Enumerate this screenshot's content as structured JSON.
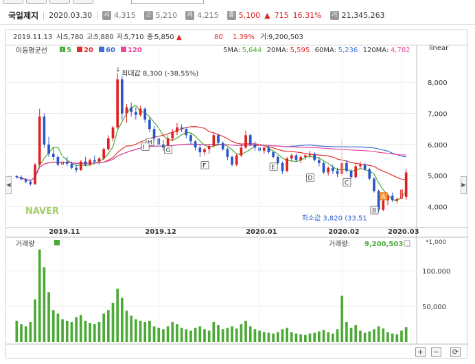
{
  "header": {
    "stock_name": "국일제지",
    "date": "2020.03.30",
    "items": [
      {
        "badge": "시",
        "value": "4,315"
      },
      {
        "badge": "고",
        "value": "5,210"
      },
      {
        "badge": "저",
        "value": "4,215"
      }
    ],
    "close_badge": "종",
    "close": "5,100",
    "change_arrow": "▲",
    "change": "715",
    "change_pct": "16.31%",
    "volume_badge": "거",
    "volume": "21,345,263"
  },
  "ohlc_line": {
    "date": "2019.11.13",
    "open_label": "시:",
    "open": "5,780",
    "high_label": "고:",
    "high": "5,880",
    "low_label": "저:",
    "low": "5,710",
    "close_label": "종:",
    "close": "5,850",
    "arrow": "▲",
    "change": "80",
    "pct": "1.39%",
    "volume_label": "거:",
    "volume": "9,200,503"
  },
  "ma_legend": {
    "title": "이동평균선",
    "periods": [
      {
        "label": "5",
        "color": "#4aaa35"
      },
      {
        "label": "20",
        "color": "#e02d2d"
      },
      {
        "label": "60",
        "color": "#3a6fd8"
      },
      {
        "label": "120",
        "color": "#e8489a"
      }
    ],
    "values": [
      {
        "label": "5MA:",
        "value": "5,644",
        "color": "#4aaa35"
      },
      {
        "label": "20MA:",
        "value": "5,595",
        "color": "#e02d2d"
      },
      {
        "label": "60MA:",
        "value": "5,236",
        "color": "#3a6fd8"
      },
      {
        "label": "120MA:",
        "value": "4,782",
        "color": "#e8489a"
      }
    ]
  },
  "scale_label": "linear",
  "price_ticks": [
    "8,000",
    "7,000",
    "6,000",
    "5,000",
    "4,000"
  ],
  "date_ticks": [
    "2019.11",
    "2019.12",
    "2020.01",
    "2020.02",
    "2020.03"
  ],
  "max_annotation": "최대값 8,300 (-38.55%)",
  "min_annotation": "최소값 3,820 (33.51",
  "watermark": "NAVER",
  "pattern_markers": [
    "A",
    "B",
    "C",
    "D",
    "E",
    "F",
    "G",
    "H",
    "I"
  ],
  "volume_panel": {
    "title": "거래량",
    "legend_label": "거래량:",
    "legend_value": "9,200,503",
    "unit": "*1,000",
    "ticks": [
      "100,000",
      "50,000"
    ]
  },
  "controls": {
    "plus": "+",
    "minus": "−",
    "refresh": "⟳"
  },
  "chart_data": {
    "type": "candlestick",
    "ylim": [
      3500,
      8800
    ],
    "volume_max_k": 130000,
    "candles": [
      [
        4980,
        5020,
        4900,
        4950,
        30
      ],
      [
        4950,
        5000,
        4850,
        4880,
        25
      ],
      [
        4880,
        4920,
        4750,
        4800,
        22
      ],
      [
        4800,
        4850,
        4680,
        4720,
        28
      ],
      [
        4720,
        5400,
        4700,
        5350,
        60
      ],
      [
        5350,
        7150,
        5300,
        6900,
        130
      ],
      [
        6900,
        7000,
        5900,
        6000,
        105
      ],
      [
        6000,
        6250,
        5600,
        5700,
        70
      ],
      [
        5700,
        5900,
        5500,
        5600,
        45
      ],
      [
        5600,
        5650,
        5300,
        5350,
        40
      ],
      [
        5350,
        5500,
        5250,
        5450,
        32
      ],
      [
        5450,
        5600,
        5300,
        5380,
        30
      ],
      [
        5380,
        5450,
        5200,
        5250,
        28
      ],
      [
        5250,
        5350,
        5100,
        5180,
        35
      ],
      [
        5180,
        5500,
        5150,
        5450,
        38
      ],
      [
        5450,
        5600,
        5300,
        5350,
        30
      ],
      [
        5350,
        5550,
        5300,
        5500,
        27
      ],
      [
        5500,
        5650,
        5400,
        5450,
        25
      ],
      [
        5450,
        5600,
        5350,
        5550,
        28
      ],
      [
        5550,
        5900,
        5500,
        5850,
        40
      ],
      [
        5850,
        6300,
        5800,
        6200,
        45
      ],
      [
        6200,
        6600,
        6100,
        6550,
        55
      ],
      [
        6550,
        8300,
        6500,
        8100,
        75
      ],
      [
        8100,
        8200,
        6800,
        7000,
        62
      ],
      [
        7000,
        7300,
        6700,
        7200,
        44
      ],
      [
        7200,
        7350,
        6900,
        7050,
        37
      ],
      [
        7050,
        7200,
        6800,
        6950,
        32
      ],
      [
        6950,
        7250,
        6900,
        7150,
        30
      ],
      [
        7150,
        7200,
        6700,
        6800,
        28
      ],
      [
        6800,
        6900,
        6400,
        6500,
        30
      ],
      [
        6500,
        6600,
        6100,
        6200,
        22
      ],
      [
        6200,
        6300,
        5900,
        6000,
        20
      ],
      [
        6000,
        6150,
        5800,
        5900,
        18
      ],
      [
        5900,
        6300,
        5850,
        6200,
        22
      ],
      [
        6200,
        6500,
        6100,
        6400,
        28
      ],
      [
        6400,
        6700,
        6300,
        6550,
        25
      ],
      [
        6550,
        6650,
        6400,
        6500,
        20
      ],
      [
        6500,
        6550,
        6200,
        6300,
        18
      ],
      [
        6300,
        6350,
        6000,
        6100,
        16
      ],
      [
        6100,
        6150,
        5800,
        5900,
        20
      ],
      [
        5900,
        6000,
        5600,
        5750,
        22
      ],
      [
        5750,
        5900,
        5650,
        5850,
        18
      ],
      [
        5850,
        6000,
        5700,
        5950,
        16
      ],
      [
        5950,
        6400,
        5900,
        6300,
        28
      ],
      [
        6300,
        6350,
        6000,
        6050,
        24
      ],
      [
        6050,
        6100,
        5800,
        5850,
        18
      ],
      [
        5850,
        5900,
        5500,
        5600,
        20
      ],
      [
        5600,
        5650,
        5300,
        5350,
        22
      ],
      [
        5350,
        5700,
        5300,
        5650,
        19
      ],
      [
        5650,
        6000,
        5600,
        5900,
        25
      ],
      [
        5900,
        6450,
        5850,
        6300,
        30
      ],
      [
        6300,
        6350,
        5950,
        6000,
        22
      ],
      [
        6000,
        6100,
        5800,
        5900,
        18
      ],
      [
        5900,
        6050,
        5750,
        5800,
        16
      ],
      [
        5800,
        5950,
        5700,
        5900,
        14
      ],
      [
        5900,
        5950,
        5700,
        5750,
        13
      ],
      [
        5750,
        5800,
        5550,
        5600,
        12
      ],
      [
        5600,
        5650,
        5350,
        5400,
        14
      ],
      [
        5400,
        5450,
        5050,
        5150,
        18
      ],
      [
        5150,
        5600,
        5100,
        5550,
        20
      ],
      [
        5550,
        5700,
        5450,
        5650,
        14
      ],
      [
        5650,
        5700,
        5450,
        5500,
        12
      ],
      [
        5500,
        5650,
        5400,
        5600,
        11
      ],
      [
        5600,
        5700,
        5500,
        5650,
        10
      ],
      [
        5650,
        5800,
        5550,
        5700,
        12
      ],
      [
        5700,
        5750,
        5450,
        5500,
        13
      ],
      [
        5500,
        5600,
        5300,
        5400,
        15
      ],
      [
        5400,
        5450,
        5050,
        5100,
        17
      ],
      [
        5100,
        5300,
        5000,
        5250,
        14
      ],
      [
        5250,
        5350,
        5050,
        5150,
        12
      ],
      [
        5150,
        5250,
        4950,
        5050,
        18
      ],
      [
        5050,
        6150,
        5000,
        5400,
        65
      ],
      [
        5400,
        5500,
        5100,
        5150,
        28
      ],
      [
        5150,
        5200,
        4900,
        4950,
        20
      ],
      [
        4950,
        5350,
        4900,
        5300,
        24
      ],
      [
        5300,
        5450,
        5200,
        5350,
        16
      ],
      [
        5350,
        5400,
        5150,
        5200,
        13
      ],
      [
        5200,
        5250,
        4850,
        4900,
        15
      ],
      [
        4900,
        4950,
        4450,
        4500,
        18
      ],
      [
        4500,
        4550,
        3820,
        3900,
        22
      ],
      [
        3900,
        4300,
        3850,
        4200,
        19
      ],
      [
        4200,
        4400,
        4050,
        4350,
        14
      ],
      [
        4350,
        4450,
        4150,
        4200,
        12
      ],
      [
        4200,
        4300,
        4100,
        4250,
        11
      ],
      [
        4250,
        4600,
        4200,
        4550,
        16
      ],
      [
        4315,
        5210,
        4215,
        5100,
        21
      ]
    ]
  }
}
